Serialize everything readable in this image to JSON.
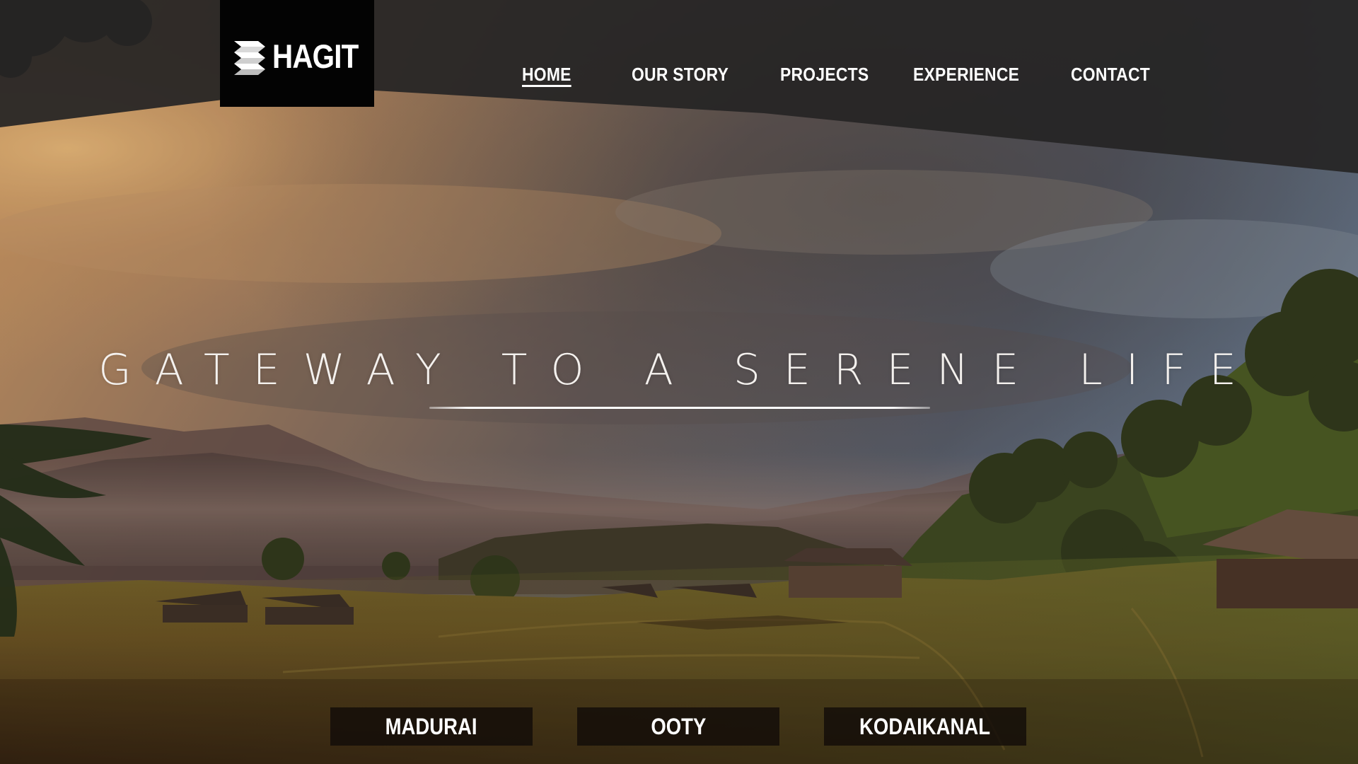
{
  "brand": {
    "logo_text": "HAGIT",
    "logo_icon": "stacked-layers-icon"
  },
  "nav": {
    "items": [
      {
        "label": "HOME",
        "active": true
      },
      {
        "label": "OUR STORY",
        "active": false
      },
      {
        "label": "PROJECTS",
        "active": false
      },
      {
        "label": "EXPERIENCE",
        "active": false
      },
      {
        "label": "CONTACT",
        "active": false
      }
    ]
  },
  "hero": {
    "headline": "GATEWAY TO A SERENE LIFE"
  },
  "locations": [
    {
      "label": "MADURAI"
    },
    {
      "label": "OOTY"
    },
    {
      "label": "KODAIKANAL"
    }
  ],
  "colors": {
    "nav_band": "#2b2a2a",
    "logo_bg": "#030303",
    "text": "#ffffff",
    "button_bg": "#120c08"
  }
}
